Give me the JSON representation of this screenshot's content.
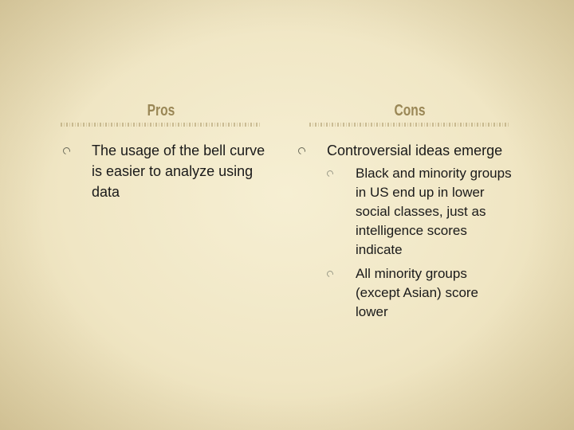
{
  "slide": {
    "pros": {
      "heading": "Pros",
      "items": [
        {
          "text": "The usage of the bell curve is easier to analyze using data"
        }
      ]
    },
    "cons": {
      "heading": "Cons",
      "items": [
        {
          "text": "Controversial ideas emerge",
          "subitems": [
            {
              "text": "Black and minority groups in US end up in lower social classes, just as intelligence scores indicate"
            },
            {
              "text": "All minority groups (except Asian) score lower"
            }
          ]
        }
      ]
    }
  },
  "colors": {
    "heading": "#9a8756",
    "body_text": "#1a1a1a",
    "background": "#f2e9c9"
  }
}
